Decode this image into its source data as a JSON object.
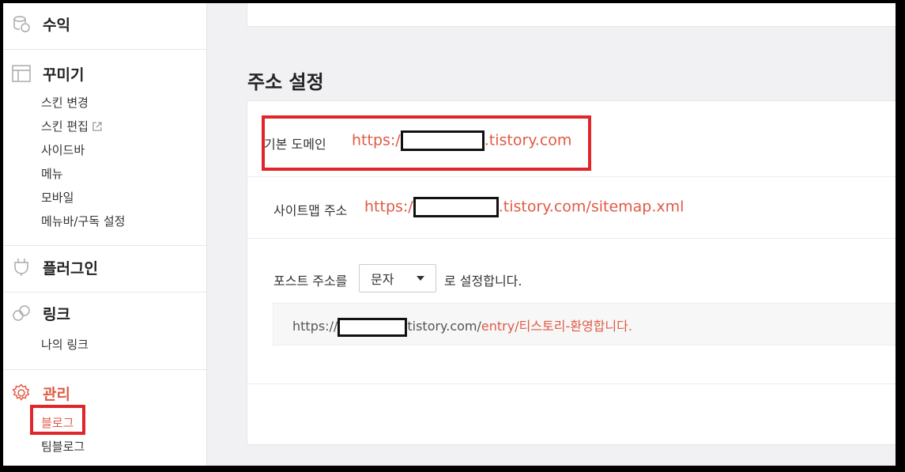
{
  "sidebar": {
    "revenue": {
      "title": "수익",
      "icon": "coins-icon"
    },
    "decorate": {
      "title": "꾸미기",
      "icon": "layout-icon",
      "items": [
        "스킨 변경",
        "스킨 편집",
        "사이드바",
        "메뉴",
        "모바일",
        "메뉴바/구독 설정"
      ]
    },
    "plugin": {
      "title": "플러그인",
      "icon": "plug-icon"
    },
    "link": {
      "title": "링크",
      "icon": "link-icon",
      "items": [
        "나의 링크"
      ]
    },
    "manage": {
      "title": "관리",
      "icon": "gear-icon",
      "items": [
        "블로그",
        "팀블로그"
      ],
      "active_item": "블로그"
    }
  },
  "main": {
    "section_title": "주소 설정",
    "default_domain": {
      "label": "기본 도메인",
      "prefix": "https:/",
      "suffix": ".tistory.com"
    },
    "sitemap": {
      "label": "사이트맵 주소",
      "prefix": "https:/",
      "suffix": ".tistory.com/sitemap.xml"
    },
    "post_address": {
      "label": "포스트 주소를",
      "selected": "문자",
      "after": "로 설정합니다.",
      "preview_prefix": "https://",
      "preview_domain": "tistory.com/",
      "preview_highlight": "entry/티스토리-환영합니다."
    }
  },
  "colors": {
    "accent": "#e05a44",
    "annotation": "#e0262a"
  }
}
